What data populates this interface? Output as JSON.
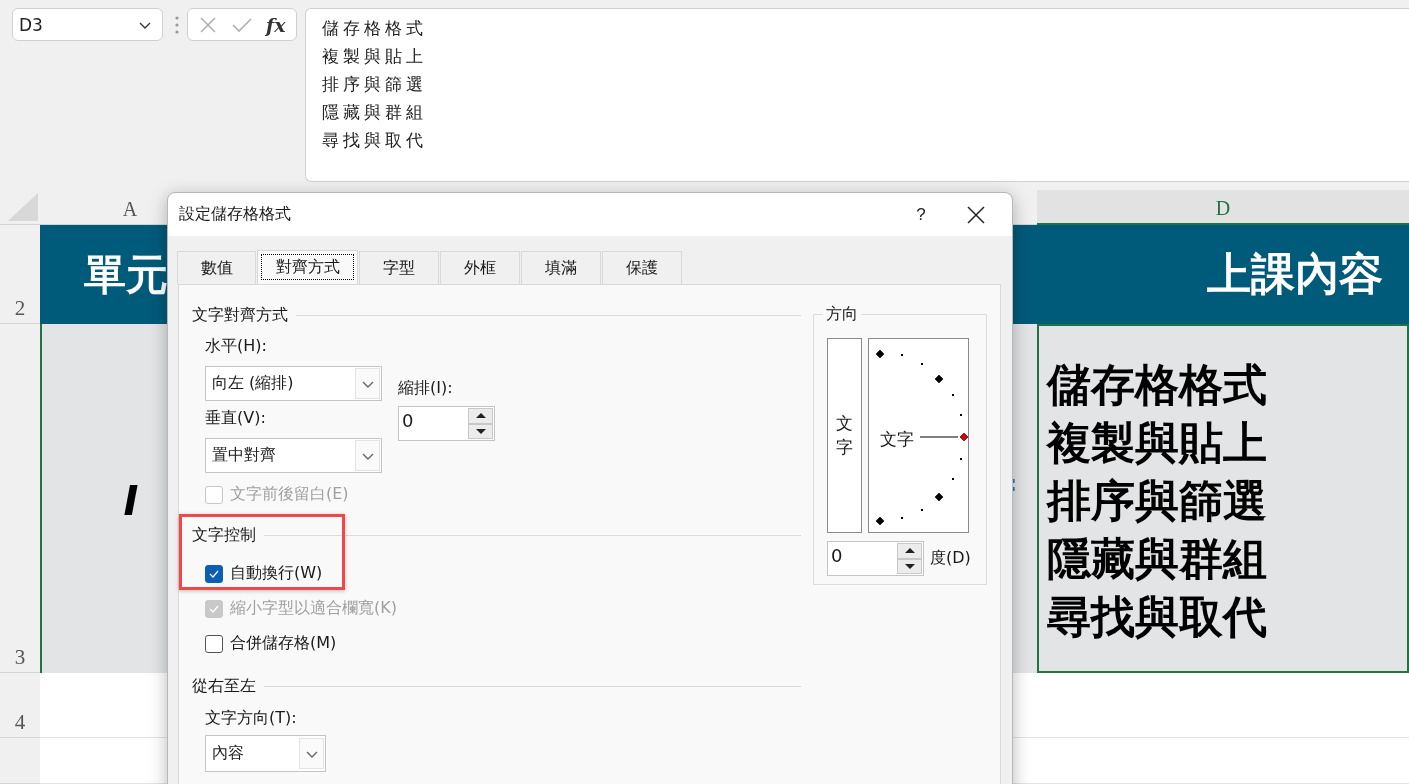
{
  "name_box": {
    "value": "D3"
  },
  "formula_bar": {
    "function_label": "fx",
    "lines": [
      "儲存格格式",
      "複製與貼上",
      "排序與篩選",
      "隱藏與群組",
      "尋找與取代"
    ]
  },
  "sheet": {
    "columns": [
      {
        "label": "A",
        "selected": false
      },
      {
        "label": "D",
        "selected": true
      }
    ],
    "rows": [
      {
        "label": "2"
      },
      {
        "label": "3"
      },
      {
        "label": "4"
      }
    ],
    "header_cells": [
      {
        "text": "單元"
      },
      {
        "text": "上課內容"
      }
    ],
    "cell_a3": "I",
    "cell_c3": ":",
    "cell_d3": {
      "selected": true,
      "lines": [
        "儲存格格式",
        "複製與貼上",
        "排序與篩選",
        "隱藏與群組",
        "尋找與取代"
      ]
    }
  },
  "dialog": {
    "title": "設定儲存格格式",
    "help": "?",
    "tabs": [
      {
        "label": "數值",
        "selected": false
      },
      {
        "label": "對齊方式",
        "selected": true
      },
      {
        "label": "字型",
        "selected": false
      },
      {
        "label": "外框",
        "selected": false
      },
      {
        "label": "填滿",
        "selected": false
      },
      {
        "label": "保護",
        "selected": false
      }
    ],
    "alignment": {
      "heading": "文字對齊方式",
      "horizontal": {
        "label": "水平(H):",
        "value": "向左 (縮排)"
      },
      "vertical": {
        "label": "垂直(V):",
        "value": "置中對齊"
      },
      "indent": {
        "label": "縮排(I):",
        "value": "0"
      },
      "justify_distributed": {
        "label": "文字前後留白(E)",
        "checked": false,
        "disabled": true
      }
    },
    "text_control": {
      "heading": "文字控制",
      "highlighted": true,
      "options": [
        {
          "label": "自動換行(W)",
          "checked": true,
          "disabled": false
        },
        {
          "label": "縮小字型以適合欄寬(K)",
          "checked": true,
          "disabled": true
        },
        {
          "label": "合併儲存格(M)",
          "checked": false,
          "disabled": false
        }
      ]
    },
    "right_to_left": {
      "heading": "從右至左",
      "direction": {
        "label": "文字方向(T):",
        "value": "內容"
      }
    },
    "orientation": {
      "heading": "方向",
      "vertical_text": "文字",
      "dial_text": "文字",
      "degrees": {
        "value": "0",
        "unit": "度(D)"
      }
    }
  }
}
